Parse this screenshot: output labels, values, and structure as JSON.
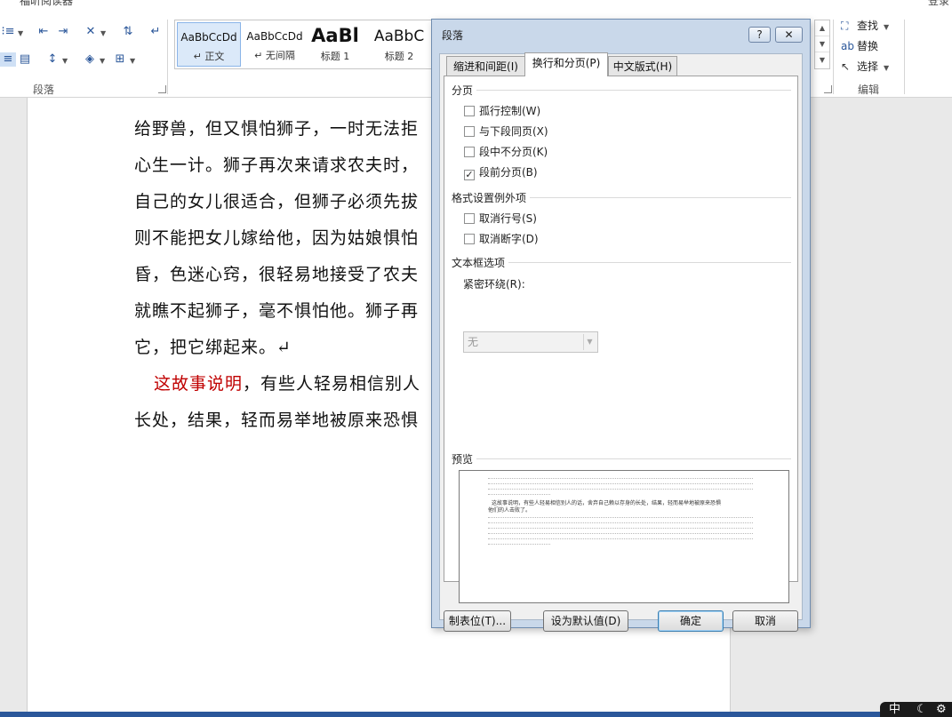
{
  "window": {
    "title_partial": "福昕阅读器",
    "login_partial": "登录"
  },
  "ribbon": {
    "paragraph_group_label": "段落",
    "editing_group_label": "编辑",
    "styles": [
      {
        "sample": "AaBbCcDd",
        "name": "↵ 正文"
      },
      {
        "sample": "AaBbCcDd",
        "name": "↵ 无间隔"
      },
      {
        "sample": "AaBl",
        "name": "标题 1"
      },
      {
        "sample": "AaBbC",
        "name": "标题 2"
      }
    ],
    "editing": {
      "find": "查找",
      "replace": "替换",
      "select": "选择"
    }
  },
  "document": {
    "lines": [
      "给野兽，但又惧怕狮子，一时无法拒",
      "心生一计。狮子再次来请求农夫时，",
      "自己的女儿很适合，但狮子必须先拔",
      "则不能把女儿嫁给他，因为姑娘惧怕",
      "昏，色迷心窍，很轻易地接受了农夫",
      "就瞧不起狮子，毫不惧怕他。狮子再",
      "它，把它绑起来。↵"
    ],
    "moral_red": "这故事说明",
    "moral_rest": "，有些人轻易相信别人",
    "last_line": "长处，结果，轻而易举地被原来恐惧"
  },
  "dialog": {
    "title": "段落",
    "help_label": "?",
    "close_label": "✕",
    "tabs": [
      "缩进和间距(I)",
      "换行和分页(P)",
      "中文版式(H)"
    ],
    "pagination": {
      "heading": "分页",
      "options": [
        {
          "label": "孤行控制(W)",
          "checked": false
        },
        {
          "label": "与下段同页(X)",
          "checked": false
        },
        {
          "label": "段中不分页(K)",
          "checked": false
        },
        {
          "label": "段前分页(B)",
          "checked": true
        }
      ]
    },
    "exceptions": {
      "heading": "格式设置例外项",
      "options": [
        {
          "label": "取消行号(S)",
          "checked": false
        },
        {
          "label": "取消断字(D)",
          "checked": false
        }
      ]
    },
    "textbox": {
      "heading": "文本框选项",
      "wrap_label": "紧密环绕(R):",
      "wrap_value": "无"
    },
    "preview": {
      "heading": "预览",
      "sample_line1": "这故事说明，有些人轻易相信别人的话，舍弃自己赖以存身的长处，结果，轻而易举地被原来恐惧",
      "sample_line2": "他们的人击败了。"
    },
    "buttons": {
      "tabs": "制表位(T)...",
      "set_default": "设为默认值(D)",
      "ok": "确定",
      "cancel": "取消"
    }
  },
  "tray": {
    "ime": "中"
  },
  "colors": {
    "accent": "#2b579a",
    "red_text": "#c00000",
    "dialog_frame": "#c9d8ea"
  }
}
